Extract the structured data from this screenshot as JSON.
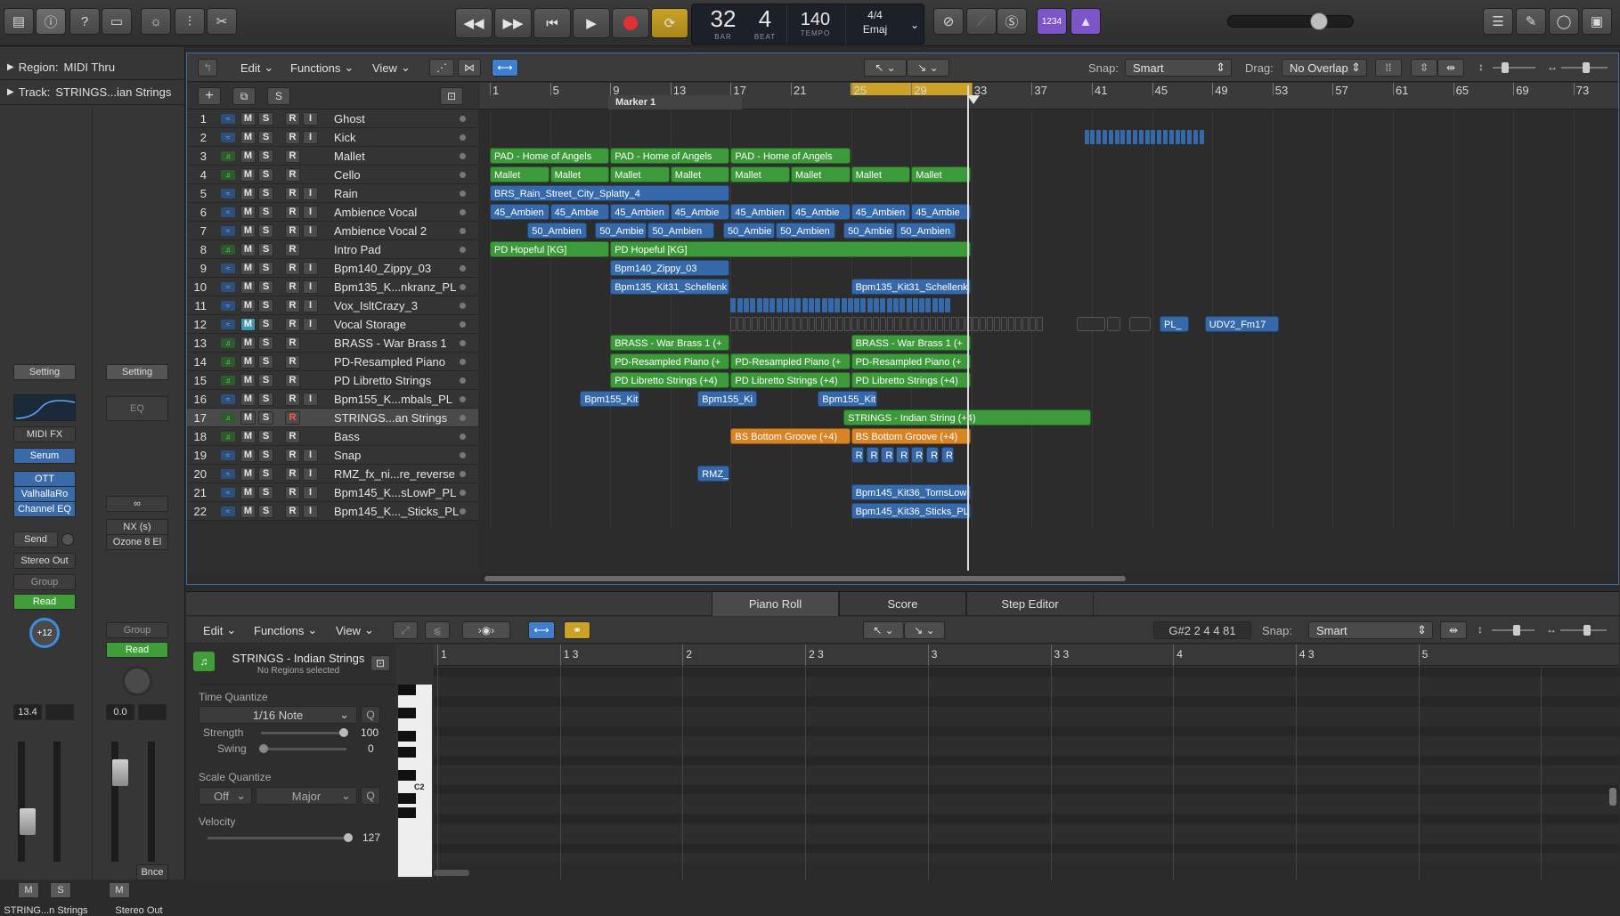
{
  "lcd": {
    "bar": "32",
    "beat": "4",
    "bar_label": "BAR",
    "beat_label": "BEAT",
    "tempo": "140",
    "tempo_label": "TEMPO",
    "signature": "4/4",
    "key": "Emaj"
  },
  "control_bar": {
    "count_in": "1234"
  },
  "inspector": {
    "region_label": "Region:",
    "region_value": "MIDI Thru",
    "track_label": "Track:",
    "track_value": "STRINGS...ian Strings",
    "strip1": {
      "setting": "Setting",
      "midifx": "MIDI FX",
      "instrument": "Serum",
      "plugins": [
        "OTT",
        "ValhallaRo",
        "Channel EQ"
      ],
      "send": "Send",
      "output": "Stereo Out",
      "group": "Group",
      "automation": "Read",
      "pan": "+12",
      "volume": "13.4",
      "mute": "M",
      "solo": "S",
      "name": "STRING...n Strings"
    },
    "strip2": {
      "setting": "Setting",
      "eq": "EQ",
      "link": "∞",
      "plugins": [
        "NX (s)",
        "Ozone 8 El"
      ],
      "group": "Group",
      "automation": "Read",
      "volume": "0.0",
      "bounce": "Bnce",
      "mute": "M",
      "name": "Stereo Out"
    }
  },
  "tracks_toolbar": {
    "edit": "Edit",
    "functions": "Functions",
    "view": "View",
    "snap_label": "Snap:",
    "snap_value": "Smart",
    "drag_label": "Drag:",
    "drag_value": "No Overlap"
  },
  "ruler": {
    "marker": "Marker 1",
    "bars": [
      "1",
      "5",
      "9",
      "13",
      "17",
      "21",
      "25",
      "29",
      "33",
      "37",
      "41",
      "45",
      "49",
      "53",
      "57",
      "61",
      "65",
      "69",
      "73"
    ]
  },
  "track_buttons": {
    "m": "M",
    "s": "S",
    "r": "R",
    "i": "I"
  },
  "tracks": [
    {
      "n": "1",
      "name": "Ghost",
      "type": "audio"
    },
    {
      "n": "2",
      "name": "Kick",
      "type": "audio"
    },
    {
      "n": "3",
      "name": "Mallet",
      "type": "inst"
    },
    {
      "n": "4",
      "name": "Cello",
      "type": "inst"
    },
    {
      "n": "5",
      "name": "Rain",
      "type": "audio"
    },
    {
      "n": "6",
      "name": "Ambience Vocal",
      "type": "audio"
    },
    {
      "n": "7",
      "name": "Ambience Vocal 2",
      "type": "audio"
    },
    {
      "n": "8",
      "name": "Intro Pad",
      "type": "inst"
    },
    {
      "n": "9",
      "name": "Bpm140_Zippy_03",
      "type": "audio"
    },
    {
      "n": "10",
      "name": "Bpm135_K...nkranz_PL",
      "type": "audio"
    },
    {
      "n": "11",
      "name": "Vox_IsltCrazy_3",
      "type": "audio"
    },
    {
      "n": "12",
      "name": "Vocal Storage",
      "type": "audio"
    },
    {
      "n": "13",
      "name": "BRASS - War Brass 1",
      "type": "inst"
    },
    {
      "n": "14",
      "name": "PD-Resampled Piano",
      "type": "inst"
    },
    {
      "n": "15",
      "name": "PD Libretto Strings",
      "type": "inst"
    },
    {
      "n": "16",
      "name": "Bpm155_K...mbals_PL",
      "type": "audio"
    },
    {
      "n": "17",
      "name": "STRINGS...an Strings",
      "type": "inst"
    },
    {
      "n": "18",
      "name": "Bass",
      "type": "inst"
    },
    {
      "n": "19",
      "name": "Snap",
      "type": "audio"
    },
    {
      "n": "20",
      "name": "RMZ_fx_ni...re_reverse",
      "type": "audio"
    },
    {
      "n": "21",
      "name": "Bpm145_K...sLowP_PL",
      "type": "audio"
    },
    {
      "n": "22",
      "name": "Bpm145_K..._Sticks_PL",
      "type": "audio"
    }
  ],
  "regions": {
    "pad": "PAD - Home of Angels",
    "mallet": "Mallet",
    "rain": "BRS_Rain_Street_City_Splatty_4",
    "amb45": "45_Ambien",
    "amb45s": "45_Ambie",
    "amb50": "50_Ambien",
    "amb50s": "50_Ambie",
    "intro": "PD Hopeful [KG]",
    "zippy": "Bpm140_Zippy_03",
    "kit31": "Bpm135_Kit31_Schellenk",
    "pl": "PL_",
    "udv": "UDV2_Fm17",
    "brass": "BRASS - War Brass 1 (+",
    "piano": "PD-Resampled Piano (+",
    "libretto": "PD Libretto Strings (+4)",
    "kit155": "Bpm155_Kit",
    "kit155s": "Bpm155_Ki",
    "strings": "STRINGS - Indian String (+4)",
    "bass": "BS Bottom Groove (+4)",
    "snap": "R",
    "rmz": "RMZ_f",
    "toms": "Bpm145_Kit36_TomsLow",
    "sticks": "Bpm145_Kit36_Sticks_PL"
  },
  "editor": {
    "tabs": [
      "Piano Roll",
      "Score",
      "Step Editor"
    ],
    "edit": "Edit",
    "functions": "Functions",
    "view": "View",
    "position": "G#2  2 4 4 81",
    "snap_label": "Snap:",
    "snap_value": "Smart",
    "region_title": "STRINGS - Indian Strings",
    "region_sub": "No Regions selected",
    "time_quantize": "Time Quantize",
    "tq_value": "1/16 Note",
    "q": "Q",
    "strength_label": "Strength",
    "strength_value": "100",
    "swing_label": "Swing",
    "swing_value": "0",
    "scale_quantize": "Scale Quantize",
    "sq_off": "Off",
    "sq_scale": "Major",
    "velocity_label": "Velocity",
    "velocity_value": "127",
    "key_label": "C2",
    "bars": [
      "1",
      "1 3",
      "2",
      "2 3",
      "3",
      "3 3",
      "4",
      "4 3",
      "5"
    ]
  }
}
